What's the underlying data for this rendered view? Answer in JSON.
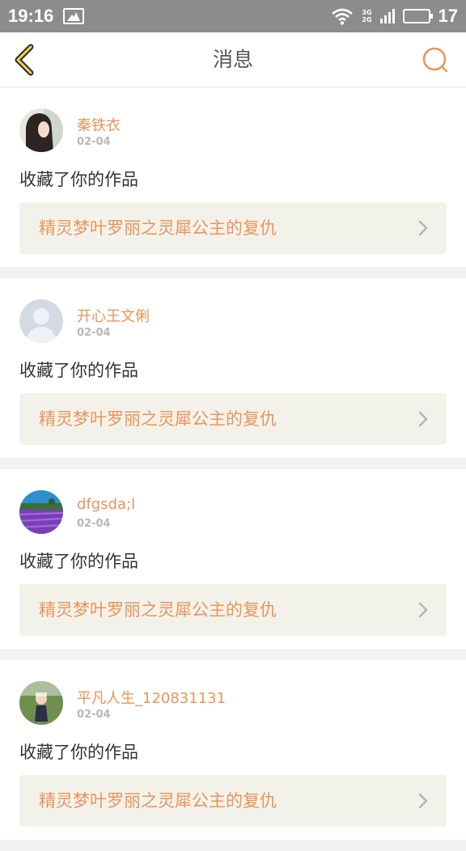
{
  "status_bar": {
    "time": "19:16",
    "network_top": "3G",
    "network_bottom": "2G",
    "battery_level": "17"
  },
  "header": {
    "title": "消息",
    "back_icon": "chevron-left-icon",
    "search_icon": "search-icon",
    "accent_color": "#e9955a"
  },
  "messages": [
    {
      "username": "秦铁衣",
      "date": "02-04",
      "action": "收藏了你的作品",
      "work_title": "精灵梦叶罗丽之灵犀公主的复仇"
    },
    {
      "username": "开心王文俐",
      "date": "02-04",
      "action": "收藏了你的作品",
      "work_title": "精灵梦叶罗丽之灵犀公主的复仇"
    },
    {
      "username": "dfgsda;l",
      "date": "02-04",
      "action": "收藏了你的作品",
      "work_title": "精灵梦叶罗丽之灵犀公主的复仇"
    },
    {
      "username": "平凡人生_120831131",
      "date": "02-04",
      "action": "收藏了你的作品",
      "work_title": "精灵梦叶罗丽之灵犀公主的复仇"
    }
  ]
}
